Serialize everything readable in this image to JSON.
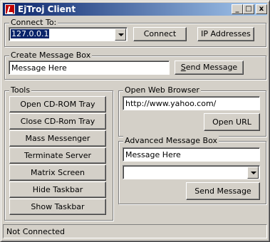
{
  "window": {
    "title": "EjTroj Client",
    "minimize": "_",
    "maximize": "□",
    "close": "x"
  },
  "connect": {
    "group_label": "Connect To:",
    "ip_value": "127.0.0.1",
    "connect_label": "Connect",
    "ip_addresses_label": "IP Addresses"
  },
  "message_box": {
    "group_label": "Create Message Box",
    "text_value": "Message Here",
    "send_label": "Send Message"
  },
  "tools": {
    "group_label": "Tools",
    "items": [
      "Open CD-ROM Tray",
      "Close CD-Rom Tray",
      "Mass Messenger",
      "Terminate Server",
      "Matrix Screen",
      "Hide Taskbar",
      "Show Taskbar"
    ]
  },
  "browser": {
    "group_label": "Open Web Browser",
    "url_value": "http://www.yahoo.com/",
    "open_label": "Open URL"
  },
  "advanced": {
    "group_label": "Advanced Message Box",
    "text_value": "Message Here",
    "type_value": "",
    "send_label": "Send Message"
  },
  "status": {
    "text": "Not Connected"
  }
}
